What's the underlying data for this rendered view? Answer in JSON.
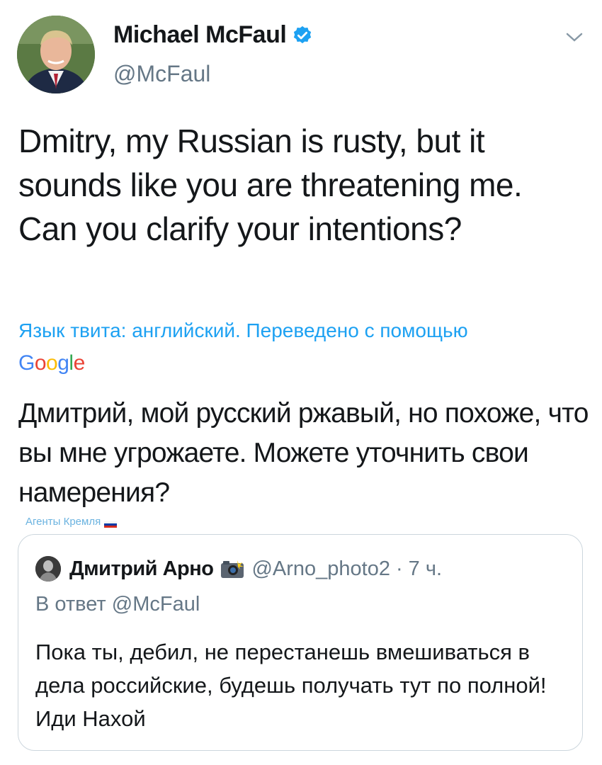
{
  "author": {
    "display_name": "Michael McFaul",
    "handle": "@McFaul",
    "verified_icon": "verified-badge-icon",
    "avatar_icon": "profile-avatar"
  },
  "tweet": {
    "text": "Dmitry, my Russian is rusty, but it sounds like you are threatening me. Can you clarify your intentions?",
    "translation_note": "Язык твита: английский. Переведено с помощью",
    "translator_logo": "Google",
    "translated_text": "Дмитрий, мой русский ржавый, но похоже, что вы мне угрожаете. Можете уточнить свои намерения?"
  },
  "watermark": "Агенты Кремля",
  "quoted": {
    "display_name": "Дмитрий Арно",
    "handle": "@Arno_photo2",
    "separator": "·",
    "time": "7 ч.",
    "reply_to": "В ответ @McFaul",
    "text": "Пока ты, дебил, не перестанешь вмешиваться в дела российские, будешь получать тут по полной! Иди Нахой"
  },
  "colors": {
    "accent": "#1da1f2",
    "muted": "#657786",
    "border": "#ccd6dd"
  }
}
